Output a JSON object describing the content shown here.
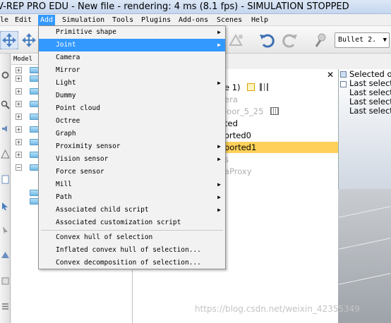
{
  "window": {
    "title": "V-REP PRO EDU - New file - rendering: 4 ms (8.1 fps) - SIMULATION STOPPED"
  },
  "menubar": {
    "items": [
      "le",
      "Edit",
      "Add",
      "Simulation",
      "Tools",
      "Plugins",
      "Add-ons",
      "Scenes",
      "Help"
    ]
  },
  "toolbar": {
    "engine": "Bullet 2."
  },
  "model_browser": {
    "header": "Model"
  },
  "add_menu": {
    "items": [
      {
        "label": "Primitive shape",
        "submenu": true
      },
      {
        "label": "Joint",
        "submenu": true,
        "highlighted": true
      },
      {
        "label": "Camera",
        "submenu": false
      },
      {
        "label": "Mirror",
        "submenu": false
      },
      {
        "label": "Light",
        "submenu": true
      },
      {
        "label": "Dummy",
        "submenu": false
      },
      {
        "label": "Point cloud",
        "submenu": false
      },
      {
        "label": "Octree",
        "submenu": false
      },
      {
        "label": "Graph",
        "submenu": false
      },
      {
        "label": "Proximity sensor",
        "submenu": true
      },
      {
        "label": "Vision sensor",
        "submenu": true
      },
      {
        "label": "Force sensor",
        "submenu": false
      },
      {
        "label": "Mill",
        "submenu": true
      },
      {
        "label": "Path",
        "submenu": true
      },
      {
        "label": "Associated child script",
        "submenu": true
      },
      {
        "label": "Associated customization script",
        "submenu": false
      }
    ],
    "items2": [
      {
        "label": "Convex hull of selection"
      },
      {
        "label": "Inflated convex hull of selection..."
      },
      {
        "label": "Convex decomposition of selection..."
      }
    ]
  },
  "scene_hierarchy": {
    "rows": [
      {
        "text": "e 1)",
        "dim": false
      },
      {
        "text": "era",
        "dim": true
      },
      {
        "text": "loor_5_25",
        "dim": true
      },
      {
        "text": "ted",
        "dim": false
      },
      {
        "text": "orted0",
        "dim": false
      },
      {
        "text": "ported1",
        "dim": false
      },
      {
        "text": "s",
        "dim": true
      },
      {
        "text": "aProxy",
        "dim": true
      }
    ]
  },
  "viewport_info": {
    "lines": [
      "Selected o",
      "Last select",
      "Last select",
      "Last select",
      "Last select"
    ]
  },
  "watermark": "https://blog.csdn.net/weixin_42355349"
}
